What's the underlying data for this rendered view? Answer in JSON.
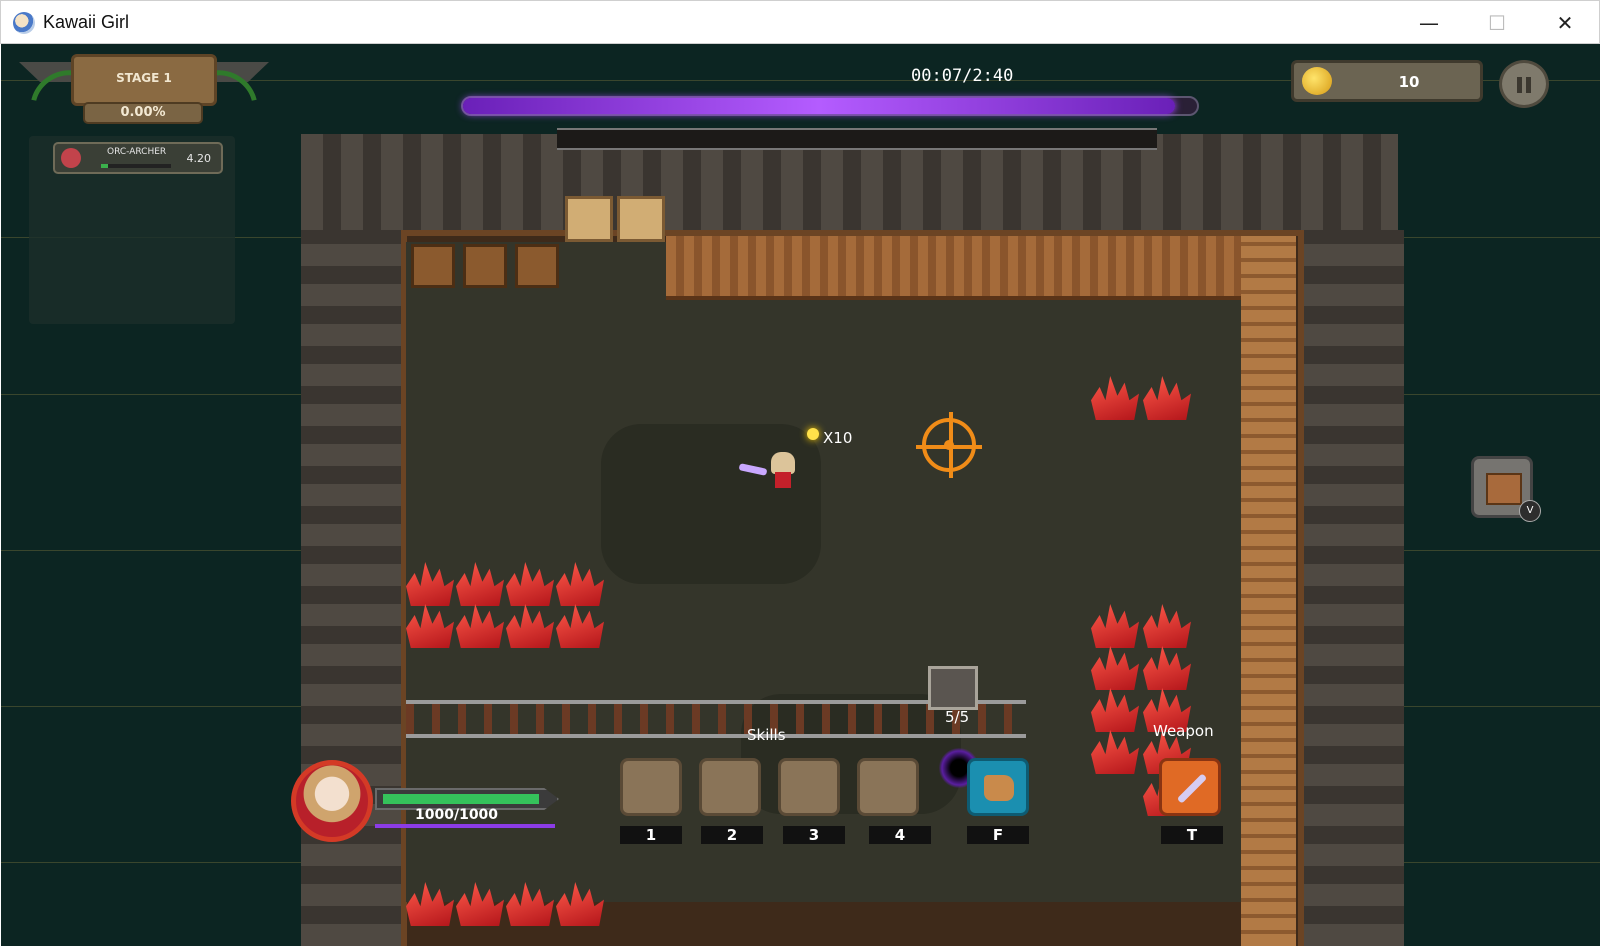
{
  "window": {
    "title": "Kawaii Girl",
    "minimize_symbol": "—",
    "maximize_symbol": "☐",
    "close_symbol": "✕"
  },
  "hud": {
    "stage_label": "STAGE 1",
    "stage_progress": "0.00%",
    "timer": "00:07/2:40",
    "timer_elapsed_fraction": 0.97,
    "coins": "10",
    "enemy": {
      "name": "ORC-ARCHER",
      "value": "4.20",
      "health_fraction": 0.1
    }
  },
  "world": {
    "pickup_text": "X10",
    "portal_count": "5/5"
  },
  "player": {
    "hp_text": "1000/1000",
    "hp_fraction": 1.0
  },
  "skills": {
    "label": "Skills",
    "slots": [
      "1",
      "2",
      "3",
      "4"
    ],
    "dash_key": "F",
    "dash_icon": "winged-boot-icon"
  },
  "weapon": {
    "label": "Weapon",
    "key": "T",
    "icon": "sword-icon"
  },
  "chest": {
    "key": "V",
    "icon": "treasure-chest-icon"
  },
  "colors": {
    "accent_purple": "#a64dff",
    "hp_green": "#35c25b",
    "crosshair": "#f08c18",
    "background": "#0c2522"
  }
}
